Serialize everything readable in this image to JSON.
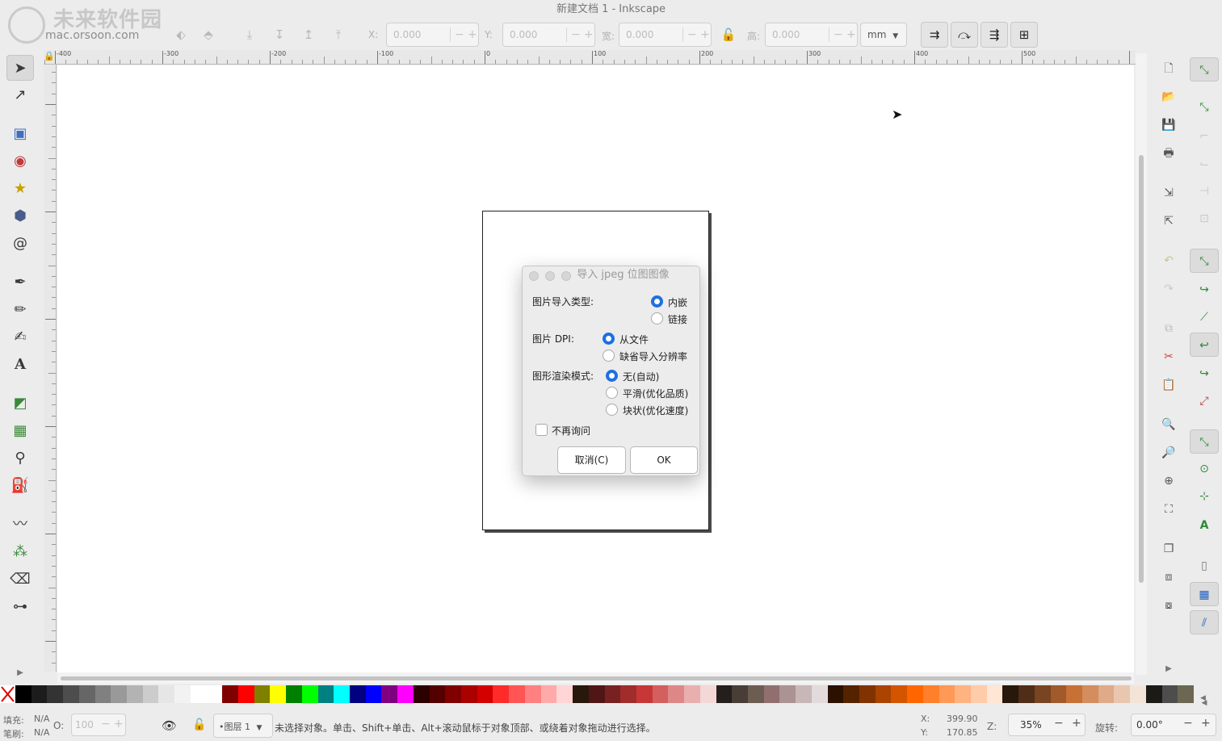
{
  "window": {
    "title": "新建文档 1 - Inkscape"
  },
  "watermark": {
    "text": "未来软件园",
    "url": "mac.orsoon.com"
  },
  "toolbar": {
    "x_label": "X:",
    "x_value": "0.000",
    "y_label": "Y:",
    "y_value": "0.000",
    "w_label": "宽:",
    "w_value": "0.000",
    "h_label": "高:",
    "h_value": "0.000",
    "unit": "mm",
    "minus": "−",
    "plus": "+"
  },
  "rulers": {
    "h_labels": [
      "-400",
      "-300",
      "-200",
      "-100",
      "0",
      "100",
      "200",
      "300",
      "400",
      "500"
    ]
  },
  "dialog": {
    "title": "导入 jpeg 位图图像",
    "import_type_label": "图片导入类型:",
    "import_type_options": [
      "内嵌",
      "链接"
    ],
    "dpi_label": "图片 DPI:",
    "dpi_options": [
      "从文件",
      "缺省导入分辨率"
    ],
    "render_label": "图形渲染模式:",
    "render_options": [
      "无(自动)",
      "平滑(优化品质)",
      "块状(优化速度)"
    ],
    "dont_ask": "不再询问",
    "cancel": "取消(C)",
    "ok": "OK"
  },
  "palette": {
    "colors": [
      "#000000",
      "#1c1c1c",
      "#333333",
      "#4d4d4d",
      "#666666",
      "#808080",
      "#999999",
      "#b3b3b3",
      "#cccccc",
      "#e6e6e6",
      "#f2f2f2",
      "#ffffff",
      "#ffffff",
      "#800000",
      "#ff0000",
      "#808000",
      "#ffff00",
      "#008000",
      "#00ff00",
      "#008080",
      "#00ffff",
      "#000080",
      "#0000ff",
      "#800080",
      "#ff00ff",
      "#2b0000",
      "#550000",
      "#800000",
      "#aa0000",
      "#d40000",
      "#ff2a2a",
      "#ff5555",
      "#ff8080",
      "#ffaaaa",
      "#ffd5d5",
      "#28170b",
      "#501616",
      "#782121",
      "#a02c2c",
      "#c83737",
      "#d35f5f",
      "#de8787",
      "#e9afaf",
      "#f4d7d7",
      "#241f1c",
      "#483e37",
      "#6c5d53",
      "#916f6f",
      "#ac9393",
      "#c8b7b7",
      "#e3dbdb",
      "#2b1100",
      "#552200",
      "#803300",
      "#aa4400",
      "#d45500",
      "#ff6600",
      "#ff7f2a",
      "#ff9955",
      "#ffb380",
      "#ffccaa",
      "#ffe6d5",
      "#28170b",
      "#502d16",
      "#784421",
      "#a05a2c",
      "#c87137",
      "#d38d5f",
      "#deaa87",
      "#e9c6af",
      "#f4e3d7",
      "#1c1a17",
      "#4d4d4d",
      "#6c6753"
    ]
  },
  "status": {
    "fill_label": "填充:",
    "fill_value": "N/A",
    "stroke_label": "笔刷:",
    "stroke_value": "N/A",
    "opacity_label": "O:",
    "opacity_value": "100",
    "layer": "•图层 1",
    "message": "未选择对象。单击、Shift+单击、Alt+滚动鼠标于对象顶部、或绕着对象拖动进行选择。",
    "cursor_x_label": "X:",
    "cursor_x": "399.90",
    "cursor_y_label": "Y:",
    "cursor_y": "170.85",
    "zoom_label": "Z:",
    "zoom": "35%",
    "rotate_label": "旋转:",
    "rotate": "0.00°",
    "minus": "−",
    "plus": "+"
  }
}
